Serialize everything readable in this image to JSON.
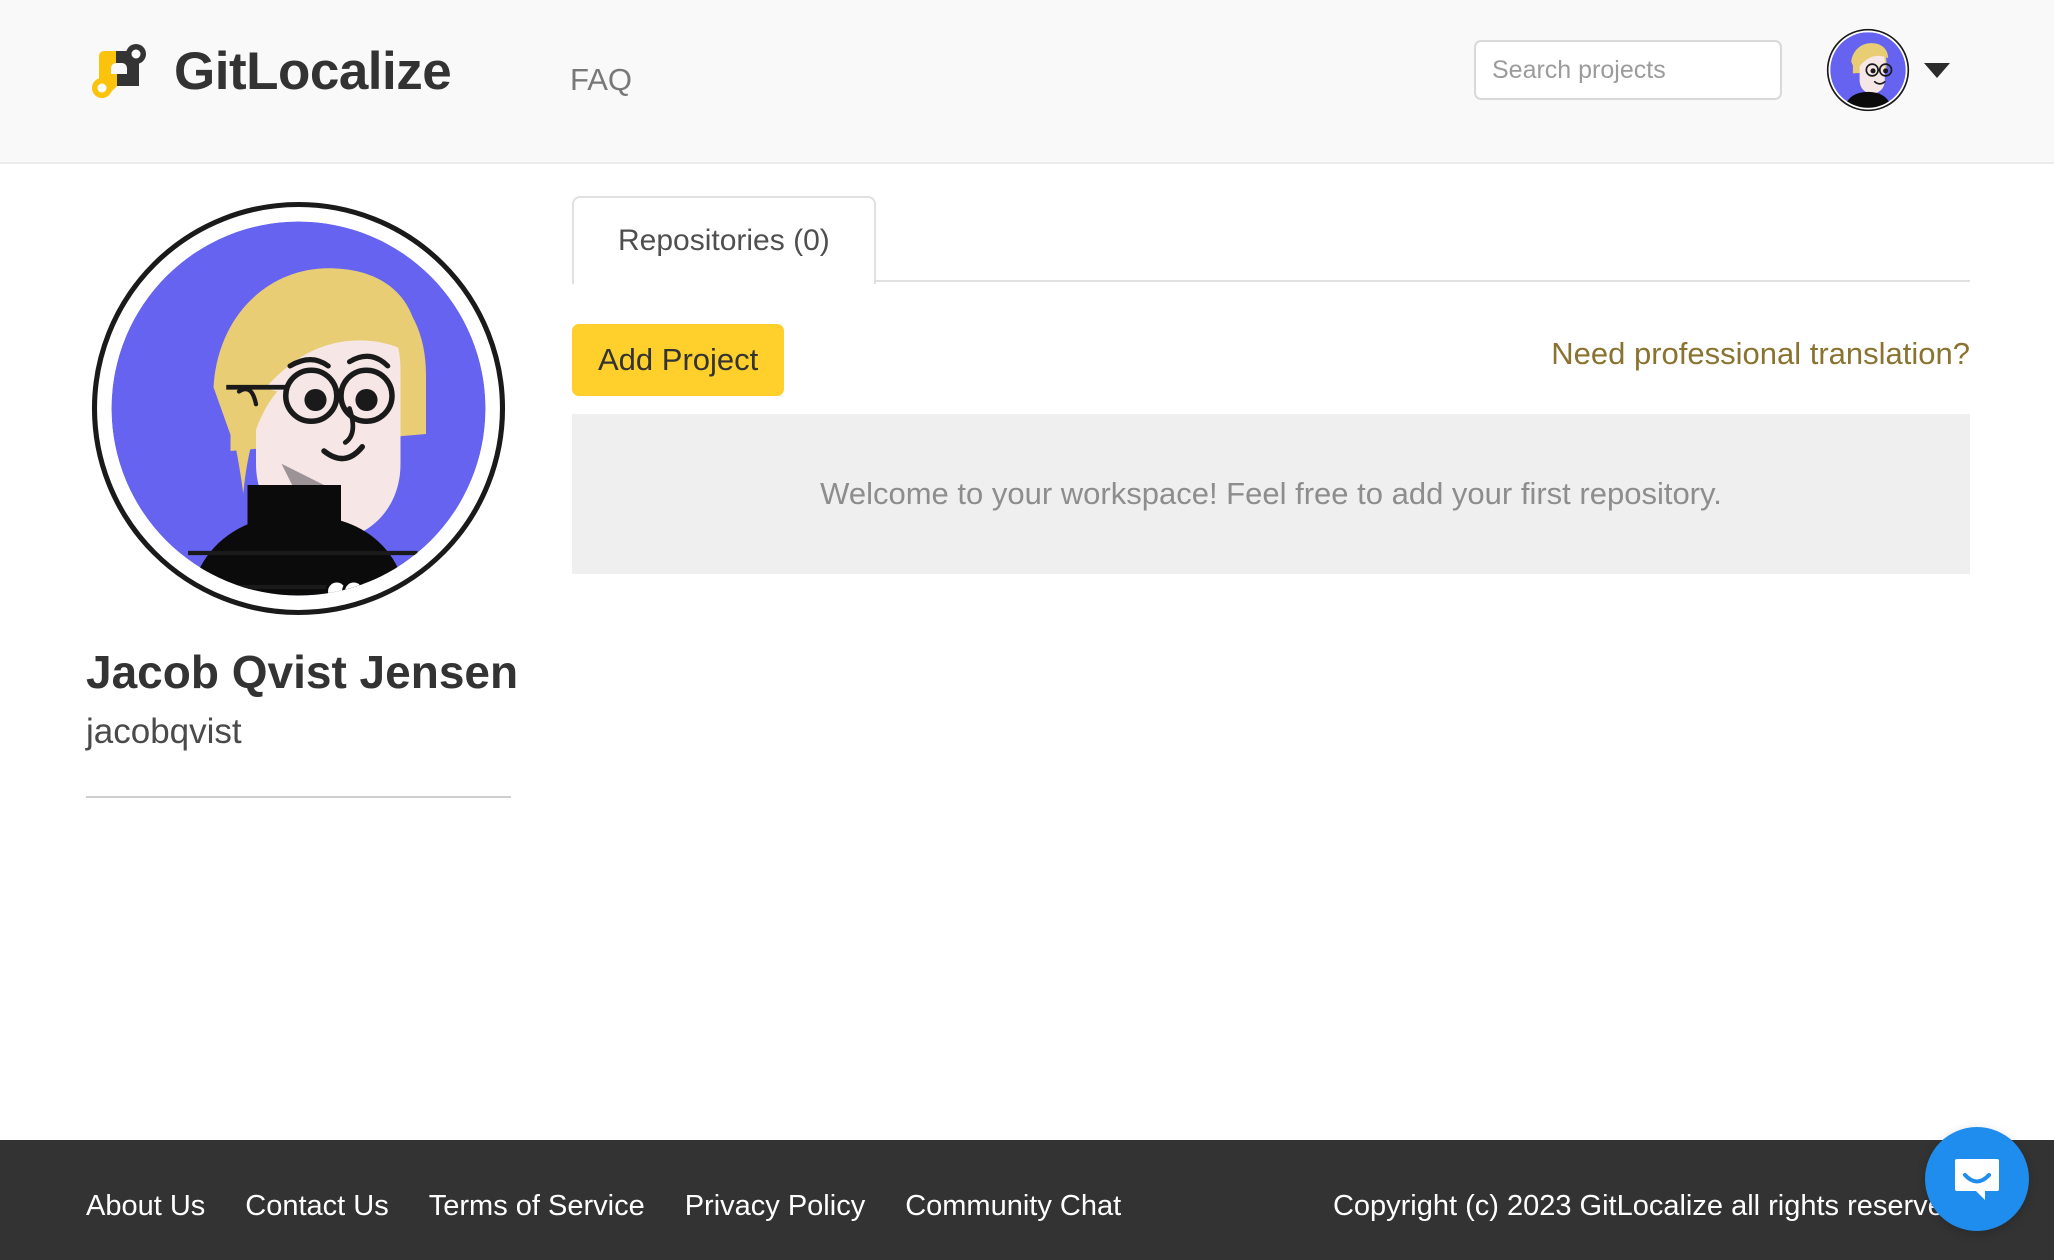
{
  "header": {
    "brand_name": "GitLocalize",
    "brand_logo_icon": "gitlocalize-logo-icon",
    "nav": {
      "faq_label": "FAQ"
    },
    "search": {
      "placeholder": "Search projects",
      "value": ""
    },
    "user_menu": {
      "avatar_icon": "user-avatar",
      "caret_icon": "chevron-down-icon"
    }
  },
  "profile": {
    "avatar_icon": "profile-avatar-illustration",
    "name": "Jacob Qvist Jensen",
    "username": "jacobqvist"
  },
  "main": {
    "tabs": [
      {
        "label": "Repositories (0)",
        "active": true
      }
    ],
    "add_project_label": "Add Project",
    "pro_translation_label": "Need professional translation?",
    "empty_state_message": "Welcome to your workspace! Feel free to add your first repository."
  },
  "footer": {
    "links": [
      {
        "label": "About Us"
      },
      {
        "label": "Contact Us"
      },
      {
        "label": "Terms of Service"
      },
      {
        "label": "Privacy Policy"
      },
      {
        "label": "Community Chat"
      }
    ],
    "copyright": "Copyright (c) 2023 GitLocalize all rights reserved."
  },
  "chat": {
    "launcher_icon": "chat-bubble-icon"
  },
  "colors": {
    "brand_yellow": "#ffcf2b",
    "brand_dark": "#333333",
    "link_gold": "#8a7330",
    "chat_blue": "#1f8ded",
    "avatar_background": "#6563f0",
    "header_background": "#f9f9fa",
    "empty_panel_background": "#efefef"
  }
}
